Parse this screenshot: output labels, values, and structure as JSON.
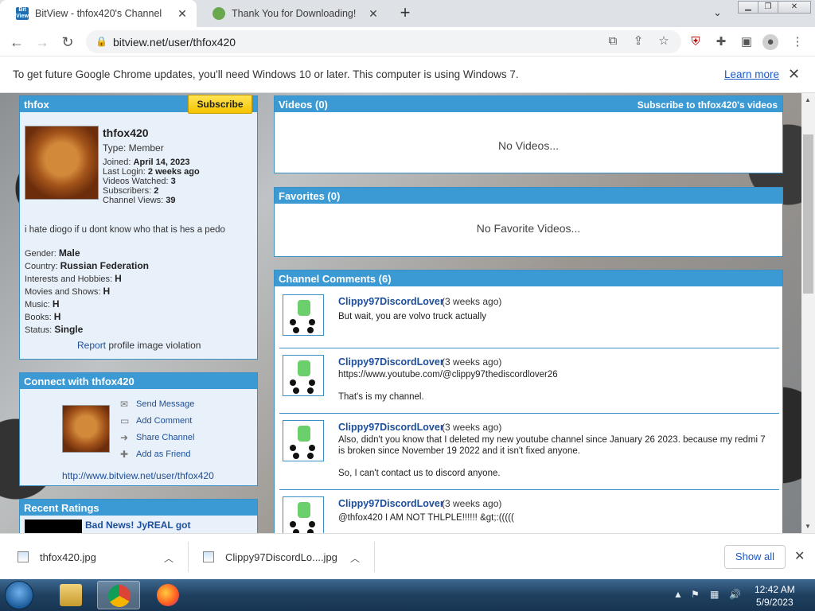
{
  "tabs": [
    {
      "title": "BitView - thfox420's Channel",
      "active": true
    },
    {
      "title": "Thank You for Downloading!",
      "active": false
    }
  ],
  "toolbar": {
    "url": "bitview.net/user/thfox420"
  },
  "infobar": {
    "message": "To get future Google Chrome updates, you'll need Windows 10 or later. This computer is using Windows 7.",
    "link": "Learn more"
  },
  "profile": {
    "header": "thfox",
    "subscribe_label": "Subscribe",
    "username": "thfox420",
    "type_line": "Type: Member",
    "joined_label": "Joined:",
    "joined": "April 14, 2023",
    "last_login_label": "Last Login:",
    "last_login": "2 weeks ago",
    "videos_watched_label": "Videos Watched:",
    "videos_watched": "3",
    "subscribers_label": "Subscribers:",
    "subscribers": "2",
    "channel_views_label": "Channel Views:",
    "channel_views": "39",
    "bio": "i hate diogo if u dont know who that is hes a pedo",
    "gender_label": "Gender:",
    "gender": "Male",
    "country_label": "Country:",
    "country": "Russian Federation",
    "interests_label": "Interests and Hobbies:",
    "interests": "H",
    "movies_label": "Movies and Shows:",
    "movies": "H",
    "music_label": "Music:",
    "music": "H",
    "books_label": "Books:",
    "books": "H",
    "status_label": "Status:",
    "status": "Single",
    "report_link": "Report",
    "report_text": "profile image violation"
  },
  "connect": {
    "header": "Connect with thfox420",
    "send_message": "Send Message",
    "add_comment": "Add Comment",
    "share_channel": "Share Channel",
    "add_friend": "Add as Friend",
    "channel_url": "http://www.bitview.net/user/thfox420"
  },
  "ratings": {
    "header": "Recent Ratings",
    "first_title": "Bad News! JyREAL got"
  },
  "videos": {
    "header": "Videos (0)",
    "subscribe_link": "Subscribe to thfox420's videos",
    "empty": "No Videos..."
  },
  "favorites": {
    "header": "Favorites (0)",
    "empty": "No Favorite Videos..."
  },
  "comments": {
    "header": "Channel Comments (6)",
    "items": [
      {
        "author": "Clippy97DiscordLover",
        "time": "(3 weeks ago)",
        "text": "But wait, you are volvo truck actually"
      },
      {
        "author": "Clippy97DiscordLover",
        "time": "(3 weeks ago)",
        "text": "https://www.youtube.com/@clippy97thediscordlover26\n\nThat's is my channel."
      },
      {
        "author": "Clippy97DiscordLover",
        "time": "(3 weeks ago)",
        "text": "Also, didn't you know that I deleted my new youtube channel since January 26 2023. because my redmi 7 is broken since November 19 2022 and it isn't fixed anyone.\n\nSo, I can't contact us to discord anyone."
      },
      {
        "author": "Clippy97DiscordLover",
        "time": "(3 weeks ago)",
        "text": "@thfox420 I AM NOT THLPLE!!!!!! &gt;:((((("
      }
    ]
  },
  "downloads": {
    "items": [
      {
        "name": "thfox420.jpg"
      },
      {
        "name": "Clippy97DiscordLo....jpg"
      }
    ],
    "show_all": "Show all"
  },
  "taskbar": {
    "time": "12:42 AM",
    "date": "5/9/2023"
  }
}
